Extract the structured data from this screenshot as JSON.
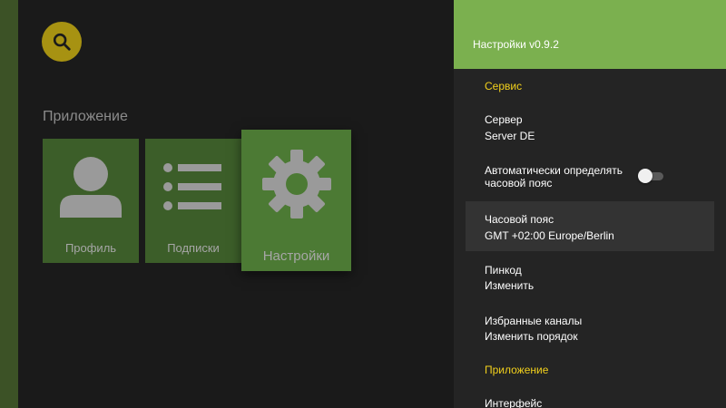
{
  "main": {
    "section_title": "Приложение",
    "tiles": [
      {
        "label": "Профиль",
        "icon": "person-icon"
      },
      {
        "label": "Подписки",
        "icon": "list-icon"
      },
      {
        "label": "Настройки",
        "icon": "gear-icon",
        "focused": true
      }
    ],
    "search_icon": "search-icon"
  },
  "settings_panel": {
    "title": "Настройки v0.9.2",
    "categories": {
      "service": "Сервис",
      "app": "Приложение"
    },
    "items": {
      "server": {
        "title": "Сервер",
        "value": "Server DE"
      },
      "auto_tz": {
        "title_line1": "Автоматически определять",
        "title_line2": "часовой пояс",
        "enabled": false
      },
      "timezone": {
        "title": "Часовой пояс",
        "value": "GMT +02:00 Europe/Berlin",
        "selected": true
      },
      "pincode": {
        "title": "Пинкод",
        "value": "Изменить"
      },
      "favorites": {
        "title": "Избранные каналы",
        "value": "Изменить порядок"
      },
      "interface": {
        "title": "Интерфейс"
      }
    }
  },
  "colors": {
    "accent_green": "#7bb04f",
    "category_yellow": "#f2d01c",
    "search_button": "#a79212",
    "tile_green": "#3c5e29"
  }
}
